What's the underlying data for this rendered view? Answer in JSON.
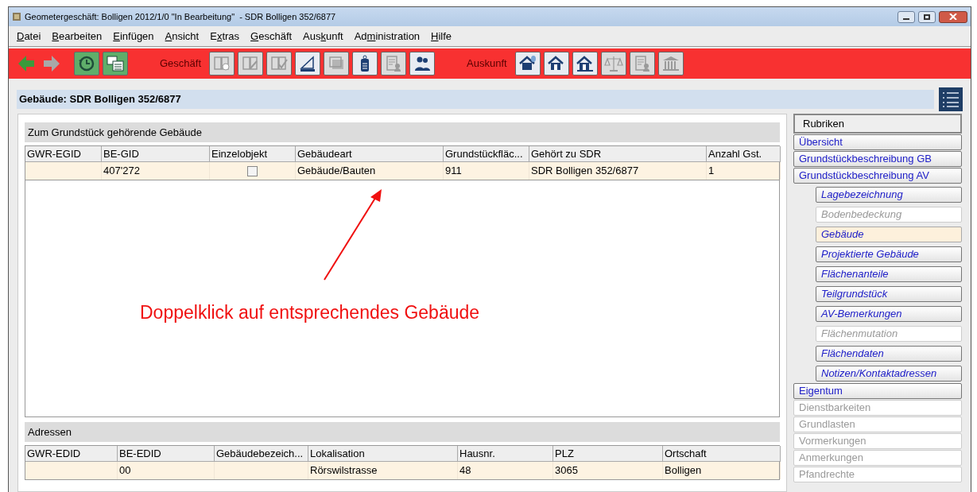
{
  "window": {
    "title": "Geometergeschäft: Bolligen 2012/1/0 \"In Bearbeitung\"  - SDR Bolligen 352/6877"
  },
  "menu": [
    {
      "key": "D",
      "post": "atei"
    },
    {
      "key": "B",
      "post": "earbeiten"
    },
    {
      "key": "E",
      "post": "infügen"
    },
    {
      "key": "A",
      "post": "nsicht"
    },
    {
      "pre": "E",
      "key": "x",
      "post": "tras"
    },
    {
      "key": "G",
      "post": "eschäft"
    },
    {
      "pre": "Aus",
      "key": "k",
      "post": "unft"
    },
    {
      "pre": "Ad",
      "key": "m",
      "post": "inistration"
    },
    {
      "key": "H",
      "post": "ilfe"
    }
  ],
  "toolbar": {
    "nav": [
      {
        "kind": "back",
        "disabled": false
      },
      {
        "kind": "forward",
        "disabled": true
      },
      {
        "kind": "history",
        "disabled": false
      },
      {
        "kind": "windows",
        "disabled": false
      }
    ],
    "groups": [
      {
        "label": "Geschäft",
        "buttons": [
          {
            "kind": "book-clock",
            "disabled": true
          },
          {
            "kind": "book-pencil",
            "disabled": true
          },
          {
            "kind": "book-check",
            "disabled": true
          },
          {
            "kind": "ruler",
            "disabled": false
          },
          {
            "kind": "monitor",
            "disabled": true
          },
          {
            "kind": "tag",
            "disabled": false
          },
          {
            "kind": "certificate",
            "disabled": true
          },
          {
            "kind": "people",
            "disabled": false
          }
        ]
      },
      {
        "label": "Auskunft",
        "buttons": [
          {
            "kind": "house-tree",
            "disabled": false
          },
          {
            "kind": "house-person",
            "disabled": false
          },
          {
            "kind": "house",
            "disabled": false
          },
          {
            "kind": "scales",
            "disabled": true
          },
          {
            "kind": "document-person",
            "disabled": true
          },
          {
            "kind": "bank",
            "disabled": true
          }
        ]
      }
    ]
  },
  "heading": "Gebäude: SDR Bolligen 352/6877",
  "buildings": {
    "title": "Zum Grundstück gehörende Gebäude",
    "columns": [
      "GWR-EGID",
      "BE-GID",
      "Einzelobjekt",
      "Gebäudeart",
      "Grundstückfläc...",
      "Gehört zu SDR",
      "Anzahl Gst."
    ],
    "rows": [
      {
        "cells": [
          "",
          "407'272",
          null,
          "Gebäude/Bauten",
          "911",
          "SDR Bolligen 352/6877",
          "1"
        ],
        "checked": false,
        "selected": true
      }
    ]
  },
  "annotation": "Doppelklick auf entsprechendes Gebäude",
  "addresses": {
    "title": "Adressen",
    "columns": [
      "GWR-EDID",
      "BE-EDID",
      "Gebäudebezeich...",
      "Lokalisation",
      "Hausnr.",
      "PLZ",
      "Ortschaft"
    ],
    "rows": [
      {
        "cells": [
          "",
          "00",
          "",
          "Rörswilstrasse",
          "48",
          "3065",
          "Bolligen"
        ],
        "selected": true
      }
    ]
  },
  "sidebar": {
    "title": "Rubriken",
    "items": [
      {
        "kind": "section",
        "label": "Übersicht",
        "disabled": false,
        "selected": false
      },
      {
        "kind": "section",
        "label": "Grundstückbeschreibung GB",
        "disabled": false,
        "selected": false
      },
      {
        "kind": "section",
        "label": "Grundstückbeschreibung AV",
        "disabled": false,
        "selected": false,
        "children": [
          {
            "label": "Lagebezeichnung",
            "disabled": false,
            "selected": false
          },
          {
            "label": "Bodenbedeckung",
            "disabled": true,
            "selected": false
          },
          {
            "label": "Gebäude",
            "disabled": false,
            "selected": true
          },
          {
            "label": "Projektierte Gebäude",
            "disabled": false,
            "selected": false
          },
          {
            "label": "Flächenanteile",
            "disabled": false,
            "selected": false
          },
          {
            "label": "Teilgrundstück",
            "disabled": false,
            "selected": false
          },
          {
            "label": "AV-Bemerkungen",
            "disabled": false,
            "selected": false
          },
          {
            "label": "Flächenmutation",
            "disabled": true,
            "selected": false
          },
          {
            "label": "Flächendaten",
            "disabled": false,
            "selected": false
          },
          {
            "label": "Notizen/Kontaktadressen",
            "disabled": false,
            "selected": false
          }
        ]
      },
      {
        "kind": "section",
        "label": "Eigentum",
        "disabled": false,
        "selected": false
      },
      {
        "kind": "section",
        "label": "Dienstbarkeiten",
        "disabled": true,
        "selected": false
      },
      {
        "kind": "section",
        "label": "Grundlasten",
        "disabled": true,
        "selected": false
      },
      {
        "kind": "section",
        "label": "Vormerkungen",
        "disabled": true,
        "selected": false
      },
      {
        "kind": "section",
        "label": "Anmerkungen",
        "disabled": true,
        "selected": false
      },
      {
        "kind": "section",
        "label": "Pfandrechte",
        "disabled": true,
        "selected": false
      }
    ]
  }
}
